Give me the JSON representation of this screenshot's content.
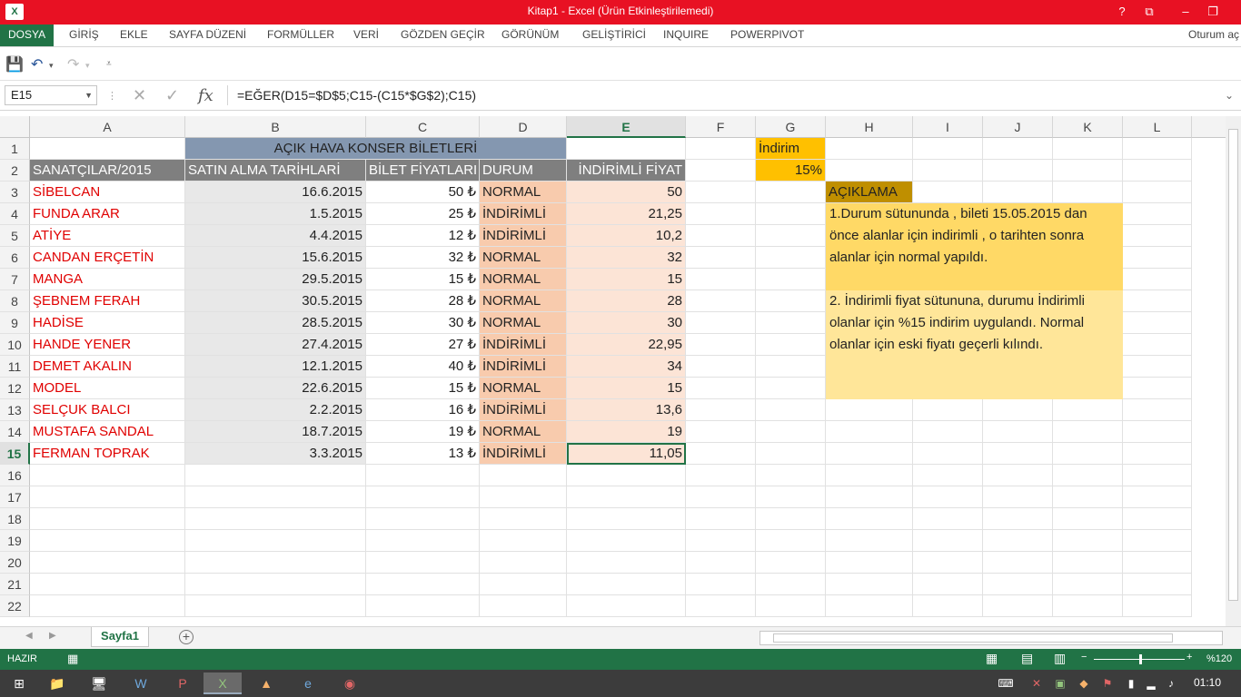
{
  "window": {
    "title": "Kitap1 -  Excel (Ürün Etkinleştirilemedi)",
    "app_icon": "excel-icon",
    "buttons": [
      "?",
      "⧉",
      "–",
      "❐"
    ]
  },
  "ribbon": {
    "tabs": [
      "DOSYA",
      "GİRİŞ",
      "EKLE",
      "SAYFA DÜZENİ",
      "FORMÜLLER",
      "VERİ",
      "GÖZDEN GEÇİR",
      "GÖRÜNÜM",
      "GELİŞTİRİCİ",
      "INQUIRE",
      "POWERPIVOT"
    ],
    "user": "Oturum aç",
    "accent": "#217346"
  },
  "formula_bar": {
    "name_box": "E15",
    "formula": "=EĞER(D15=$D$5;C15-(C15*$G$2);C15)",
    "fx_label": "fx"
  },
  "columns": [
    "A",
    "B",
    "C",
    "D",
    "E",
    "F",
    "G",
    "H",
    "I",
    "J",
    "K",
    "L"
  ],
  "rows": [
    "1",
    "2",
    "3",
    "4",
    "5",
    "6",
    "7",
    "8",
    "9",
    "10",
    "11",
    "12",
    "13",
    "14",
    "15",
    "16",
    "17",
    "18",
    "19",
    "20",
    "21",
    "22"
  ],
  "selected_cell": {
    "column": "E",
    "row": "15"
  },
  "sheet": {
    "title": "AÇIK HAVA KONSER BİLETLERİ",
    "headers": [
      "SANATÇILAR/2015",
      "SATIN ALMA TARİHLARİ",
      "BİLET FİYATLARI",
      "DURUM",
      "İNDİRİMLİ FİYAT"
    ],
    "data": [
      [
        "SİBELCAN",
        "16.6.2015",
        "50 ₺",
        "NORMAL",
        "50"
      ],
      [
        "FUNDA ARAR",
        "1.5.2015",
        "25 ₺",
        "İNDİRİMLİ",
        "21,25"
      ],
      [
        "ATİYE",
        "4.4.2015",
        "12 ₺",
        "İNDİRİMLİ",
        "10,2"
      ],
      [
        "CANDAN ERÇETİN",
        "15.6.2015",
        "32 ₺",
        "NORMAL",
        "32"
      ],
      [
        "MANGA",
        "29.5.2015",
        "15 ₺",
        "NORMAL",
        "15"
      ],
      [
        "ŞEBNEM FERAH",
        "30.5.2015",
        "28 ₺",
        "NORMAL",
        "28"
      ],
      [
        "HADİSE",
        "28.5.2015",
        "30 ₺",
        "NORMAL",
        "30"
      ],
      [
        "HANDE YENER",
        "27.4.2015",
        "27 ₺",
        "İNDİRİMLİ",
        "22,95"
      ],
      [
        "DEMET AKALIN",
        "12.1.2015",
        "40 ₺",
        "İNDİRİMLİ",
        "34"
      ],
      [
        "MODEL",
        "22.6.2015",
        "15 ₺",
        "NORMAL",
        "15"
      ],
      [
        "SELÇUK BALCI",
        "2.2.2015",
        "16 ₺",
        "İNDİRİMLİ",
        "13,6"
      ],
      [
        "MUSTAFA SANDAL",
        "18.7.2015",
        "19 ₺",
        "NORMAL",
        "19"
      ],
      [
        "FERMAN TOPRAK",
        "3.3.2015",
        "13 ₺",
        "İNDİRİMLİ",
        "11,05"
      ]
    ],
    "discount_label": "İndirim",
    "discount_value": "15%",
    "explanation_title": "AÇIKLAMA",
    "explanation_1": [
      "1.Durum sütununda , bileti 15.05.2015 dan",
      "önce alanlar için indirimli , o tarihten sonra",
      "alanlar için normal yapıldı."
    ],
    "explanation_2": [
      "2. İndirimli fiyat sütununa, durumu İndirimli",
      "olanlar için %15 indirim uygulandı. Normal",
      "olanlar için eski fiyatı geçerli kılındı."
    ]
  },
  "sheet_tabs": [
    "Sayfa1"
  ],
  "status": {
    "mode": "HAZIR",
    "zoom": "%120"
  },
  "taskbar": {
    "clock": "01:10",
    "apps": [
      "windows-start-icon",
      "file-explorer-icon",
      "remote-desktop-icon",
      "word-icon",
      "powerpoint-icon",
      "excel-icon",
      "vlc-icon",
      "internet-explorer-icon",
      "chrome-icon"
    ]
  }
}
